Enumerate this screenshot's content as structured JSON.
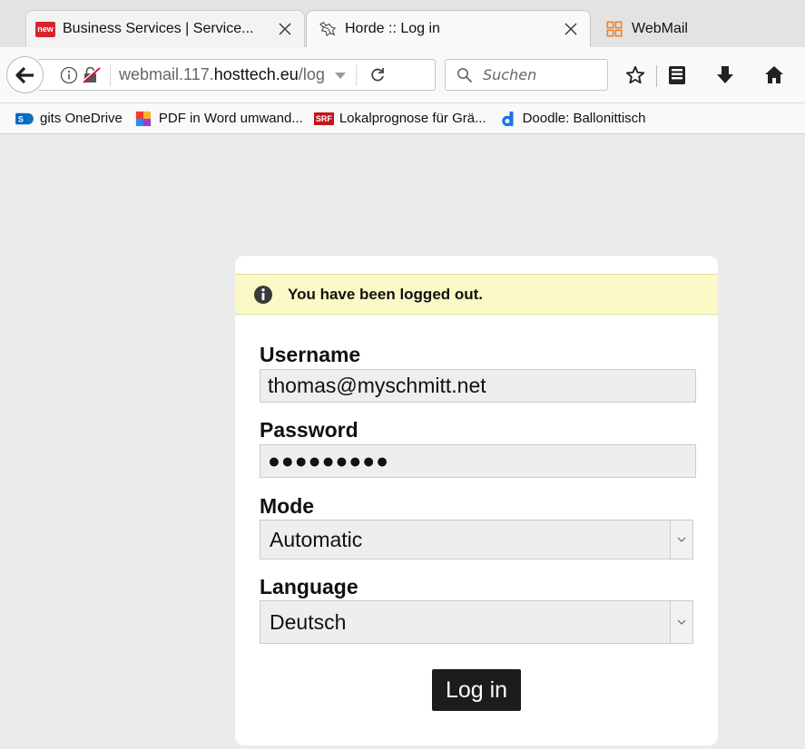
{
  "tabs": [
    {
      "title": "Business Services | Service...",
      "favicon_label": "new"
    },
    {
      "title": "Horde :: Log in"
    },
    {
      "title": "WebMail"
    }
  ],
  "urlbar": {
    "url_prefix": "webmail.117.",
    "url_domain": "hosttech.eu",
    "url_suffix": "/log"
  },
  "search": {
    "placeholder": "Suchen"
  },
  "bookmarks": [
    {
      "label": "gits OneDrive"
    },
    {
      "label": "PDF in Word umwand..."
    },
    {
      "label": "Lokalprognose für Grä...",
      "icon_label": "SRF"
    },
    {
      "label": "Doodle: Ballonittisch"
    }
  ],
  "login": {
    "notice": "You have been logged out.",
    "username_label": "Username",
    "username_value": "thomas@myschmitt.net",
    "password_label": "Password",
    "password_value": "●●●●●●●●●",
    "mode_label": "Mode",
    "mode_value": "Automatic",
    "language_label": "Language",
    "language_value": "Deutsch",
    "submit_label": "Log in"
  },
  "colors": {
    "accent": "#f07f2a",
    "notice_bg": "#fbf9c6",
    "button_bg": "#1c1c1c"
  }
}
